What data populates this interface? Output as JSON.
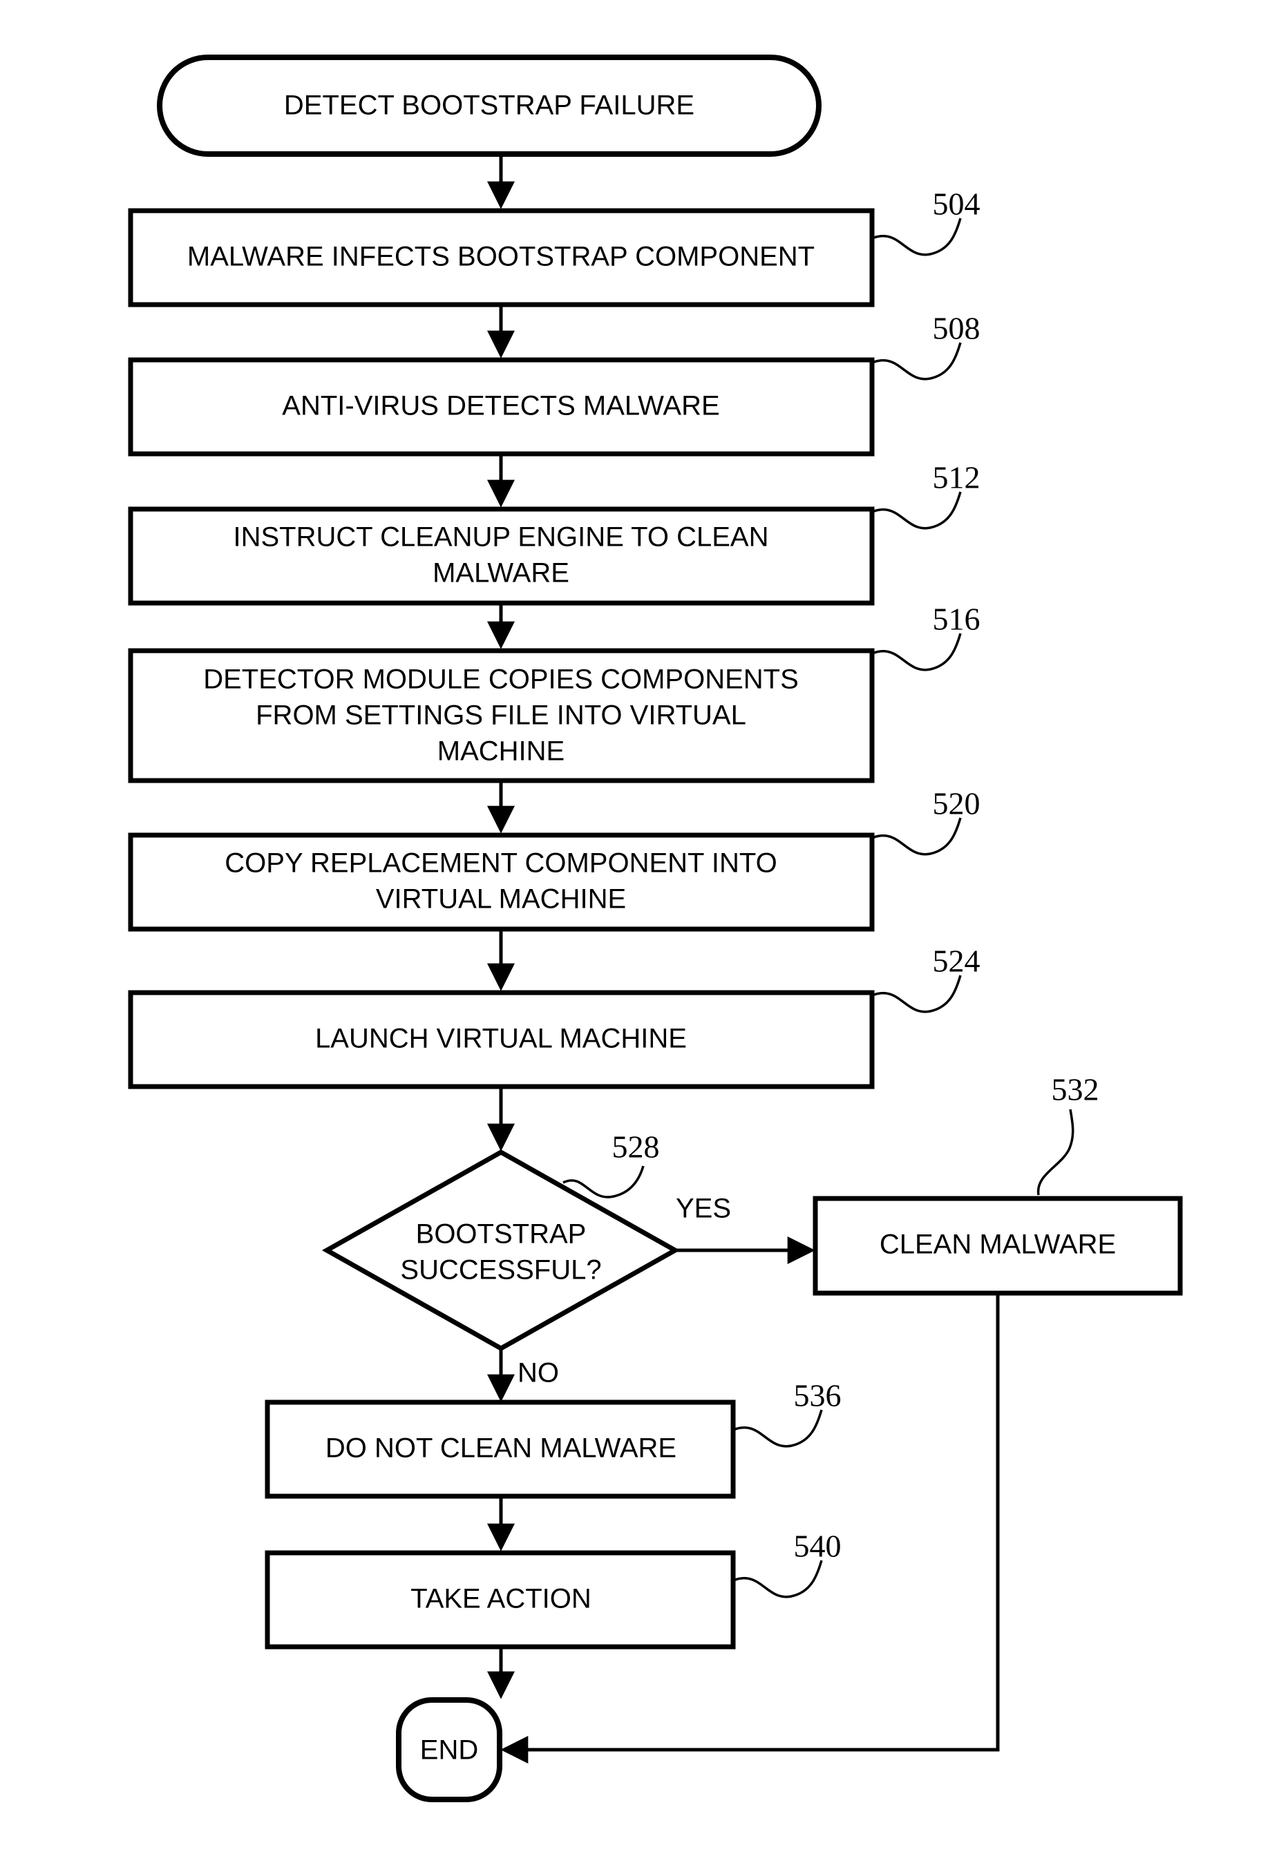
{
  "figure": {
    "kind": "flowchart",
    "title": "Bootstrap failure detection and malware cleanup flowchart"
  },
  "nodes": {
    "start": {
      "label": "DETECT BOOTSTRAP FAILURE",
      "shape": "stadium"
    },
    "n504": {
      "label": "MALWARE INFECTS BOOTSTRAP COMPONENT",
      "ref": "504",
      "shape": "rect"
    },
    "n508": {
      "label": "ANTI-VIRUS DETECTS MALWARE",
      "ref": "508",
      "shape": "rect"
    },
    "n512": {
      "line1": "INSTRUCT CLEANUP ENGINE TO CLEAN",
      "line2": "MALWARE",
      "ref": "512",
      "shape": "rect"
    },
    "n516": {
      "line1": "DETECTOR MODULE COPIES COMPONENTS",
      "line2": "FROM SETTINGS FILE INTO VIRTUAL",
      "line3": "MACHINE",
      "ref": "516",
      "shape": "rect"
    },
    "n520": {
      "line1": "COPY REPLACEMENT COMPONENT INTO",
      "line2": "VIRTUAL MACHINE",
      "ref": "520",
      "shape": "rect"
    },
    "n524": {
      "label": "LAUNCH VIRTUAL MACHINE",
      "ref": "524",
      "shape": "rect"
    },
    "n528": {
      "line1": "BOOTSTRAP",
      "line2": "SUCCESSFUL?",
      "ref": "528",
      "shape": "diamond"
    },
    "n532": {
      "label": "CLEAN MALWARE",
      "ref": "532",
      "shape": "rect"
    },
    "n536": {
      "label": "DO NOT CLEAN MALWARE",
      "ref": "536",
      "shape": "rect"
    },
    "n540": {
      "label": "TAKE ACTION",
      "ref": "540",
      "shape": "rect"
    },
    "end": {
      "label": "END",
      "shape": "stadium"
    }
  },
  "edge_labels": {
    "yes": "YES",
    "no": "NO"
  },
  "colors": {
    "stroke": "#000000",
    "fill": "#ffffff",
    "text": "#000000"
  }
}
